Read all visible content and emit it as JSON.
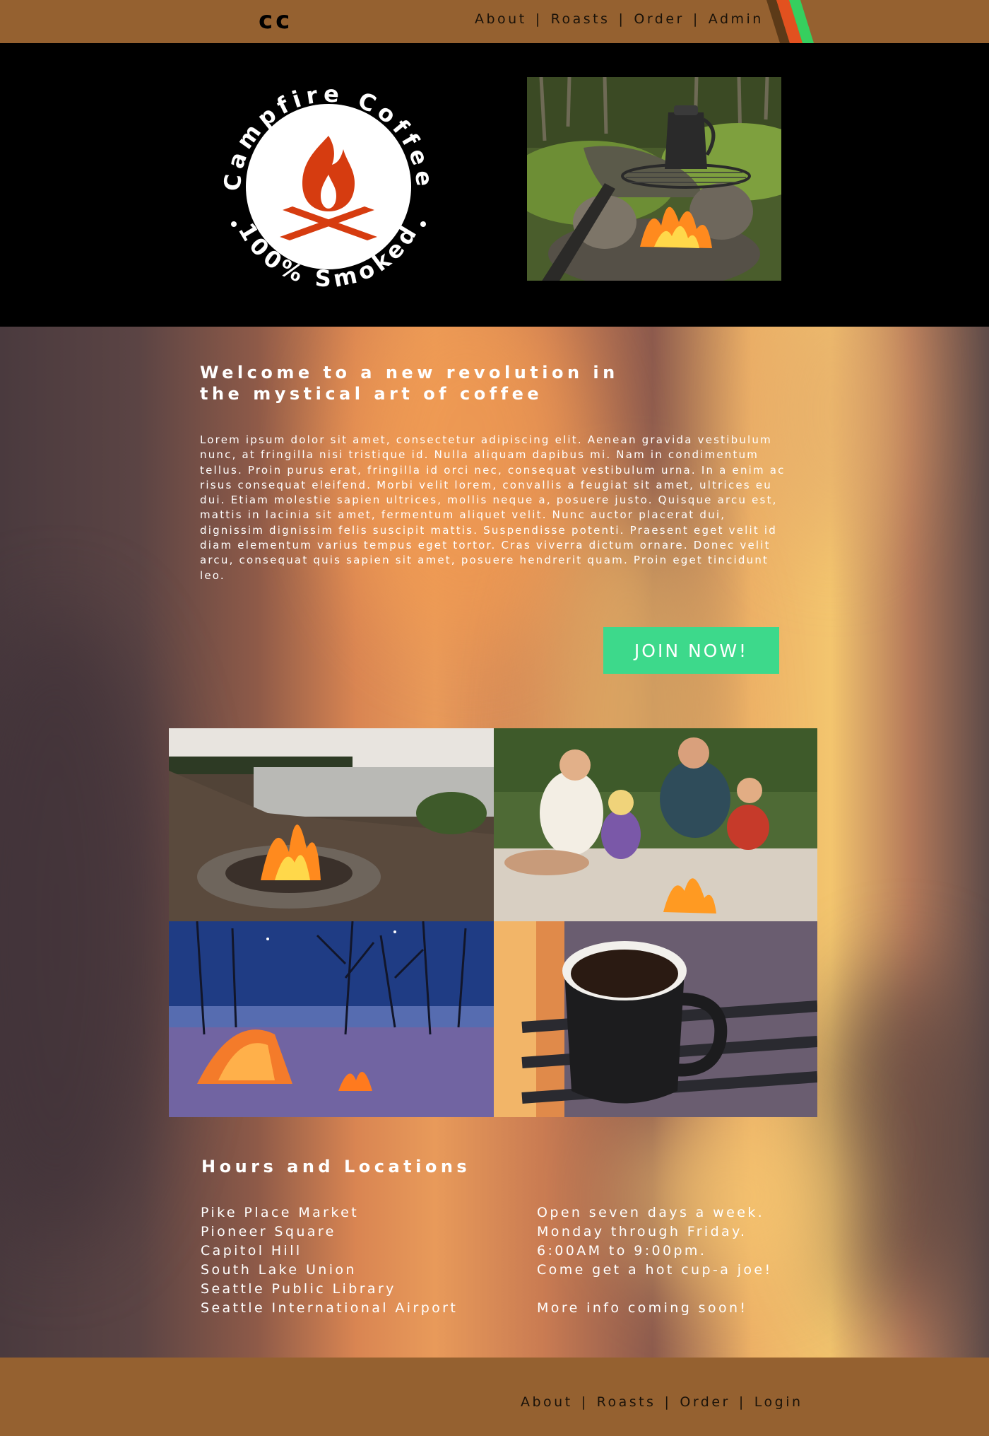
{
  "header": {
    "brand": "cc",
    "nav": [
      {
        "label": "About"
      },
      {
        "label": "Roasts"
      },
      {
        "label": "Order"
      },
      {
        "label": "Admin"
      }
    ],
    "separator": "|"
  },
  "hero": {
    "logo": {
      "arc_top_text": "Campfire Coffee",
      "arc_bottom_text": "100% Smoked",
      "icon": "campfire-icon"
    },
    "photo": "coffee-pot-over-campfire-photo"
  },
  "main": {
    "headline": "Welcome to a new revolution in the mystical art of coffee",
    "body": "Lorem ipsum dolor sit amet, consectetur adipiscing elit. Aenean gravida vestibulum nunc, at fringilla nisi tristique id. Nulla aliquam dapibus mi. Nam in condimentum tellus. Proin purus erat, fringilla id orci nec, consequat vestibulum urna. In a enim ac risus consequat eleifend. Morbi velit lorem, convallis a feugiat sit amet, ultrices eu dui. Etiam molestie sapien ultrices, mollis neque a, posuere justo. Quisque arcu est, mattis in lacinia sit amet, fermentum aliquet velit. Nunc auctor placerat dui, dignissim dignissim felis suscipit mattis. Suspendisse potenti. Praesent eget velit id diam elementum varius tempus eget tortor. Cras viverra dictum ornare. Donec velit arcu, consequat quis sapien sit amet, posuere hendrerit quam. Proin eget tincidunt leo.",
    "cta": "JOIN NOW!"
  },
  "gallery": [
    {
      "name": "lakeside-campfire-photo"
    },
    {
      "name": "family-roasting-marshmallows-photo"
    },
    {
      "name": "snowy-tent-campfire-photo"
    },
    {
      "name": "coffee-mug-photo"
    }
  ],
  "hours": {
    "title": "Hours and Locations",
    "locations": [
      "Pike Place Market",
      "Pioneer Square",
      "Capitol Hill",
      "South Lake Union",
      "Seattle Public Library",
      "Seattle International Airport"
    ],
    "info": [
      "Open seven days a week.",
      "Monday through Friday.",
      "6:00AM to 9:00pm.",
      "Come get a hot cup-a joe!",
      "",
      "More info coming soon!"
    ]
  },
  "footer": {
    "nav": [
      {
        "label": "About"
      },
      {
        "label": "Roasts"
      },
      {
        "label": "Order"
      },
      {
        "label": "Login"
      }
    ],
    "separator": "|"
  },
  "colors": {
    "bar": "#956130",
    "cta": "#3dd98b",
    "logo_flame": "#d63c10",
    "stripe_orange": "#e2511f",
    "stripe_green": "#36cf5e",
    "stripe_dark": "#5c3a18"
  }
}
